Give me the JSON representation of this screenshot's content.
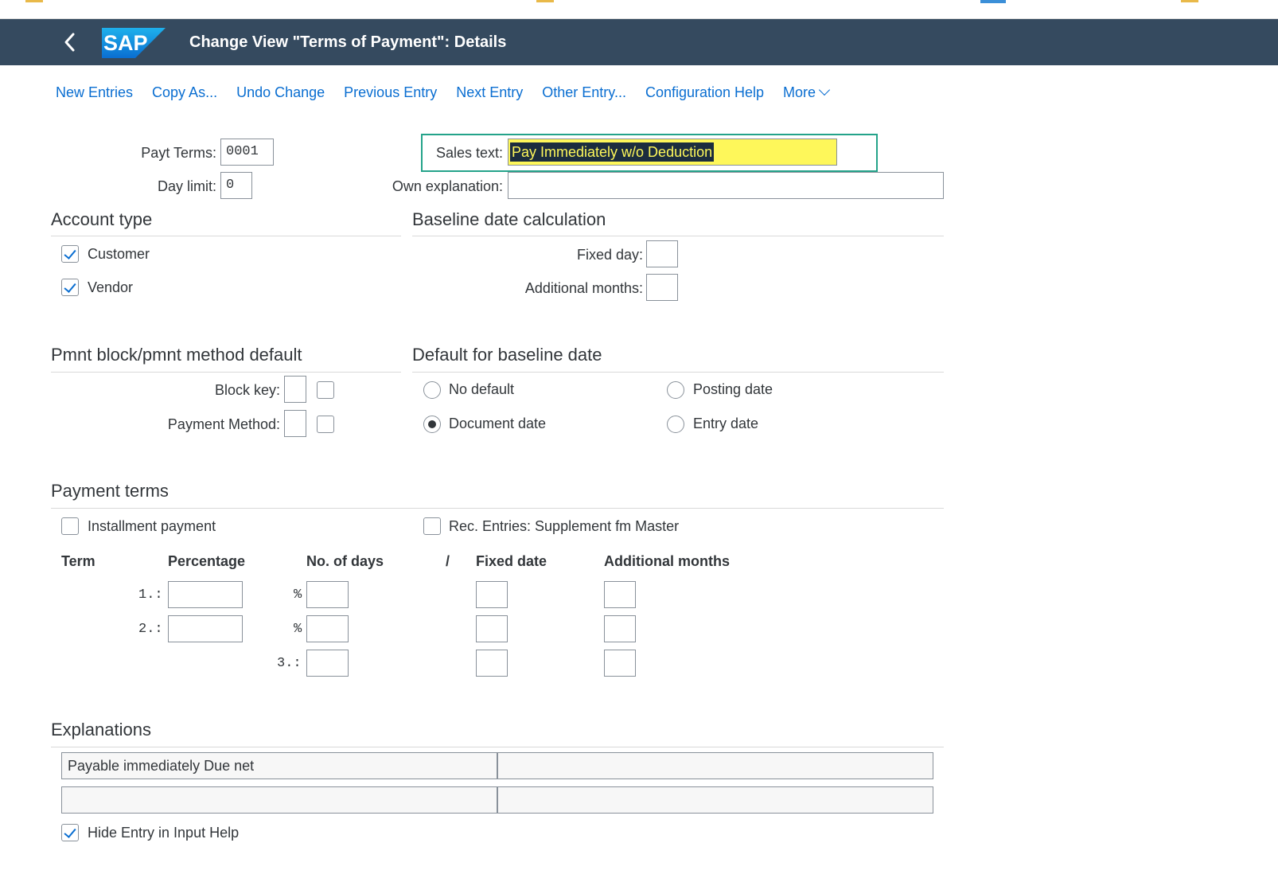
{
  "header": {
    "title": "Change View \"Terms of Payment\": Details",
    "logo_text": "SAP",
    "back_icon": "chevron-left-icon",
    "shell_color": "#354a5f"
  },
  "toolbar": {
    "items": [
      "New Entries",
      "Copy As...",
      "Undo Change",
      "Previous Entry",
      "Next Entry",
      "Other Entry...",
      "Configuration Help",
      "More"
    ],
    "link_color": "#0a6ed1"
  },
  "fields": {
    "payt_terms_label": "Payt Terms:",
    "payt_terms_value": "0001",
    "day_limit_label": "Day limit:",
    "day_limit_value": "0",
    "sales_text_label": "Sales text:",
    "sales_text_value": "Pay Immediately w/o Deduction",
    "own_explanation_label": "Own explanation:",
    "own_explanation_value": ""
  },
  "account_type": {
    "heading": "Account type",
    "customer_label": "Customer",
    "customer_checked": true,
    "vendor_label": "Vendor",
    "vendor_checked": true
  },
  "baseline_calc": {
    "heading": "Baseline date calculation",
    "fixed_day_label": "Fixed day:",
    "fixed_day_value": "",
    "additional_months_label": "Additional months:",
    "additional_months_value": ""
  },
  "pmnt_block": {
    "heading": "Pmnt block/pmnt method default",
    "block_key_label": "Block key:",
    "payment_method_label": "Payment Method:"
  },
  "default_baseline": {
    "heading": "Default for baseline date",
    "no_default": "No default",
    "posting_date": "Posting date",
    "document_date": "Document date",
    "entry_date": "Entry date",
    "selected": "Document date"
  },
  "payment_terms": {
    "heading": "Payment terms",
    "installment_label": "Installment payment",
    "rec_entries_label": "Rec. Entries: Supplement fm Master",
    "col_term": "Term",
    "col_percentage": "Percentage",
    "col_days": "No. of days",
    "col_slash": "/",
    "col_fixed_date": "Fixed date",
    "col_add_months": "Additional months",
    "row1_label": "1.:",
    "row2_label": "2.:",
    "row3_label": "3.:",
    "percent_sign": "%"
  },
  "explanations": {
    "heading": "Explanations",
    "line1_left": "Payable immediately Due net",
    "line1_right": "",
    "line2_left": "",
    "line2_right": "",
    "hide_entry_label": "Hide Entry in Input Help",
    "hide_entry_checked": true
  },
  "colors": {
    "highlight_border": "#24a38a",
    "selection_bg": "#fef75a",
    "selection_text_bg": "#1c2d3e"
  }
}
